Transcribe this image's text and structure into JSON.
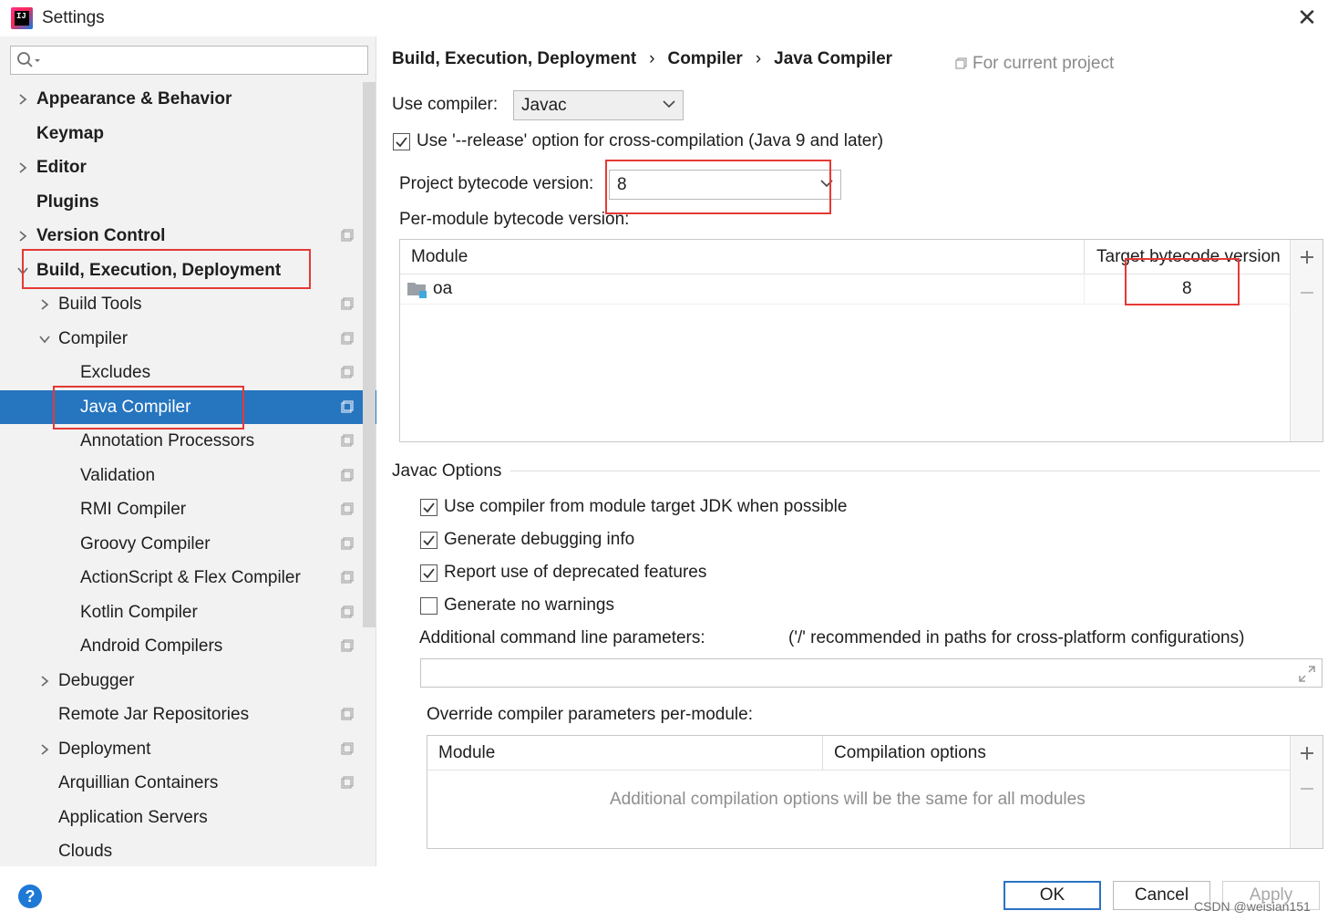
{
  "window": {
    "title": "Settings",
    "close_glyph": "✕"
  },
  "sidebar": {
    "search": {
      "placeholder": ""
    },
    "items": [
      {
        "label": "Appearance & Behavior",
        "arrow": "right"
      },
      {
        "label": "Keymap"
      },
      {
        "label": "Editor",
        "arrow": "right"
      },
      {
        "label": "Plugins"
      },
      {
        "label": "Version Control",
        "arrow": "right"
      },
      {
        "label": "Build, Execution, Deployment",
        "arrow": "down"
      },
      {
        "label": "Build Tools",
        "arrow": "right"
      },
      {
        "label": "Compiler",
        "arrow": "down"
      },
      {
        "label": "Excludes"
      },
      {
        "label": "Java Compiler"
      },
      {
        "label": "Annotation Processors"
      },
      {
        "label": "Validation"
      },
      {
        "label": "RMI Compiler"
      },
      {
        "label": "Groovy Compiler"
      },
      {
        "label": "ActionScript & Flex Compiler"
      },
      {
        "label": "Kotlin Compiler"
      },
      {
        "label": "Android Compilers"
      },
      {
        "label": "Debugger",
        "arrow": "right"
      },
      {
        "label": "Remote Jar Repositories"
      },
      {
        "label": "Deployment",
        "arrow": "right"
      },
      {
        "label": "Arquillian Containers"
      },
      {
        "label": "Application Servers"
      },
      {
        "label": "Clouds"
      }
    ],
    "selected": "Java Compiler",
    "help_glyph": "?"
  },
  "breadcrumb": {
    "parts": [
      "Build, Execution, Deployment",
      "Compiler",
      "Java Compiler"
    ],
    "separator": "›",
    "scope": "For current project"
  },
  "compiler": {
    "use_compiler_label": "Use compiler:",
    "use_compiler_value": "Javac",
    "release_option_label": "Use '--release' option for cross-compilation (Java 9 and later)",
    "release_option_checked": true,
    "project_bytecode_label": "Project bytecode version:",
    "project_bytecode_value": "8",
    "per_module_label": "Per-module bytecode version:",
    "module_table": {
      "columns": [
        "Module",
        "Target bytecode version"
      ],
      "rows": [
        {
          "module": "oa",
          "target": "8"
        }
      ]
    }
  },
  "javac": {
    "section_title": "Javac Options",
    "options": [
      {
        "label": "Use compiler from module target JDK when possible",
        "checked": true
      },
      {
        "label": "Generate debugging info",
        "checked": true
      },
      {
        "label": "Report use of deprecated features",
        "checked": true
      },
      {
        "label": "Generate no warnings",
        "checked": false
      }
    ],
    "additional_params_label": "Additional command line parameters:",
    "additional_params_hint": "('/' recommended in paths for cross-platform configurations)",
    "additional_params_value": "",
    "override_label": "Override compiler parameters per-module:",
    "override_table": {
      "columns": [
        "Module",
        "Compilation options"
      ],
      "empty_text": "Additional compilation options will be the same for all modules"
    }
  },
  "buttons": {
    "ok": "OK",
    "cancel": "Cancel",
    "apply": "Apply"
  },
  "watermark": "CSDN @weisian151",
  "colors": {
    "selection": "#2675bf",
    "highlight_box": "#e53935",
    "ok_border": "#2a73c6"
  }
}
